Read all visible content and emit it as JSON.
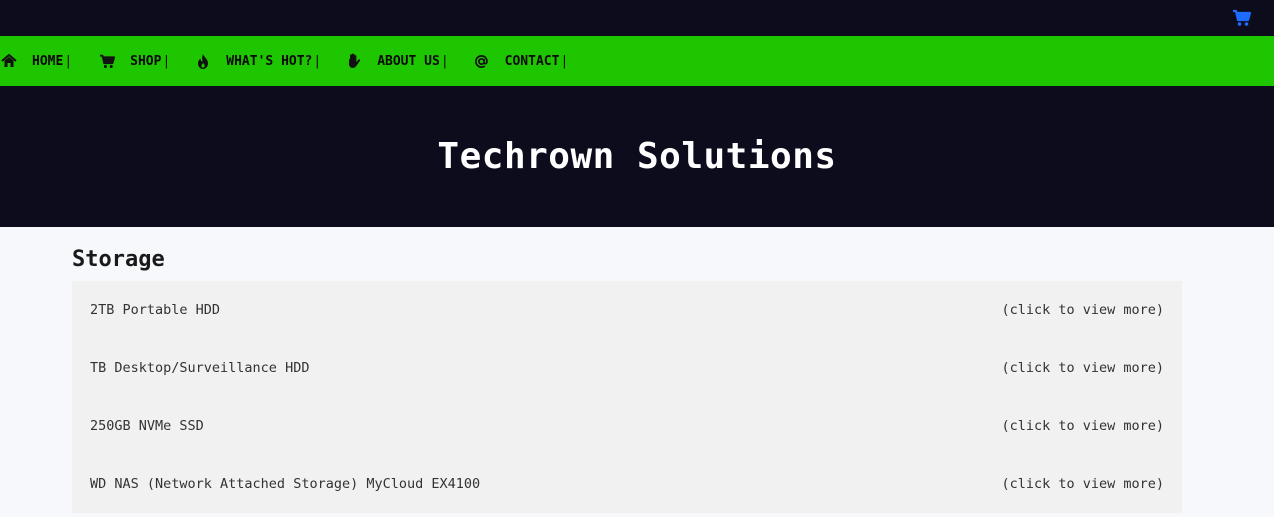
{
  "header": {
    "cart_icon": "shopping-cart-icon",
    "cart_color": "#1e6bff"
  },
  "nav": {
    "items": [
      {
        "label": "HOME",
        "icon": "home-icon"
      },
      {
        "label": "SHOP",
        "icon": "shopping-cart-icon"
      },
      {
        "label": "WHAT'S HOT?",
        "icon": "fire-icon"
      },
      {
        "label": "ABOUT US",
        "icon": "hand-icon"
      },
      {
        "label": "CONTACT",
        "icon": "at-icon"
      }
    ],
    "separator": "|",
    "background": "#1ec600"
  },
  "hero": {
    "title": "Techrown Solutions",
    "background": "#0d0c1d"
  },
  "section": {
    "title": "Storage",
    "items": [
      {
        "name": "2TB Portable HDD",
        "action": "(click to view more)"
      },
      {
        "name": "TB Desktop/Surveillance HDD",
        "action": "(click to view more)"
      },
      {
        "name": "250GB NVMe SSD",
        "action": "(click to view more)"
      },
      {
        "name": "WD NAS (Network Attached Storage) MyCloud EX4100",
        "action": "(click to view more)"
      }
    ]
  }
}
